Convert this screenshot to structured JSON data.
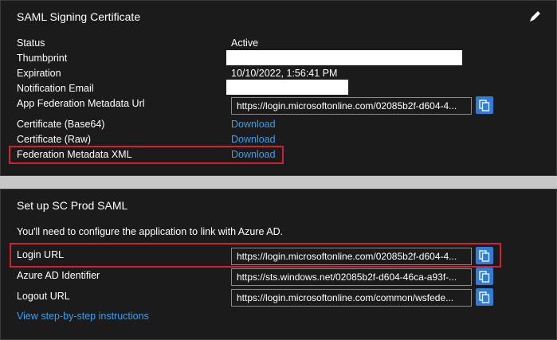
{
  "cert_panel": {
    "title": "SAML Signing Certificate",
    "edit_icon": "pencil-icon",
    "rows": {
      "status": {
        "label": "Status",
        "value": "Active"
      },
      "thumbprint": {
        "label": "Thumbprint"
      },
      "expiration": {
        "label": "Expiration",
        "value": "10/10/2022, 1:56:41 PM"
      },
      "notification_email": {
        "label": "Notification Email"
      },
      "metadata_url": {
        "label": "App Federation Metadata Url",
        "value": "https://login.microsoftonline.com/02085b2f-d604-4..."
      },
      "cert_base64": {
        "label": "Certificate (Base64)",
        "link": "Download"
      },
      "cert_raw": {
        "label": "Certificate (Raw)",
        "link": "Download"
      },
      "federation_xml": {
        "label": "Federation Metadata XML",
        "link": "Download"
      }
    }
  },
  "setup_panel": {
    "title": "Set up SC Prod SAML",
    "intro": "You'll need to configure the application to link with Azure AD.",
    "rows": {
      "login_url": {
        "label": "Login URL",
        "value": "https://login.microsoftonline.com/02085b2f-d604-4..."
      },
      "azure_ad_identifier": {
        "label": "Azure AD Identifier",
        "value": "https://sts.windows.net/02085b2f-d604-46ca-a93f-..."
      },
      "logout_url": {
        "label": "Logout URL",
        "value": "https://login.microsoftonline.com/common/wsfede..."
      }
    },
    "instructions_link": "View step-by-step instructions"
  },
  "icons": {
    "copy": "copy-icon",
    "edit": "pencil-icon"
  },
  "colors": {
    "panel_bg": "#1b1b1b",
    "link": "#3b9ee8",
    "copy_button": "#2f7bd6",
    "highlight": "#d2202f"
  }
}
